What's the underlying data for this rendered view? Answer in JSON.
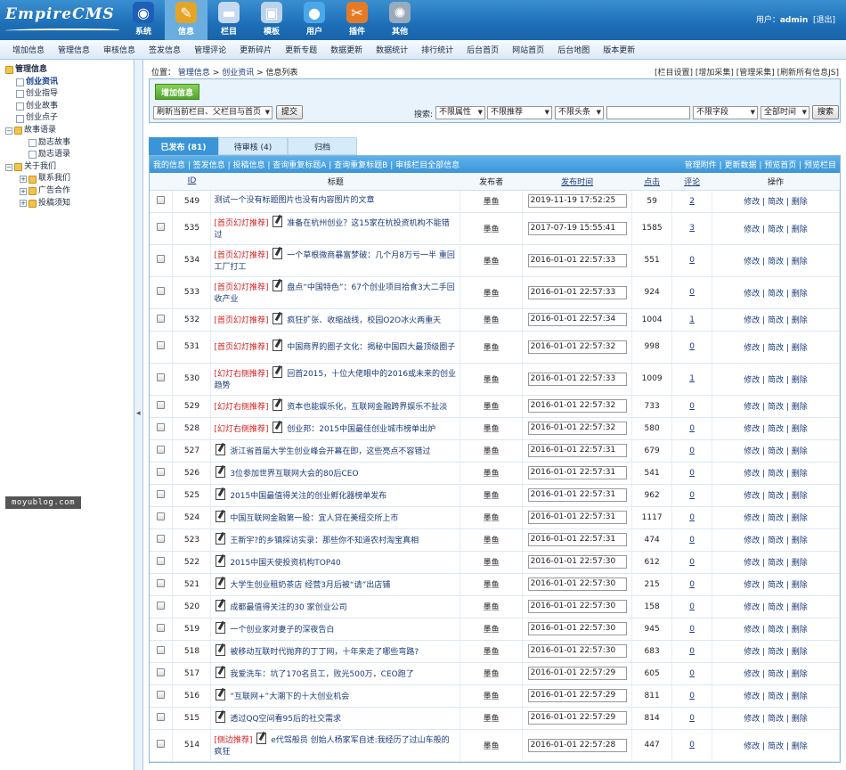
{
  "app": {
    "logo": "EmpireCMS"
  },
  "topnav": [
    {
      "label": "系统",
      "icon": "globe-icon"
    },
    {
      "label": "信息",
      "icon": "document-icon",
      "active": true
    },
    {
      "label": "栏目",
      "icon": "folder-icon"
    },
    {
      "label": "模板",
      "icon": "window-icon"
    },
    {
      "label": "用户",
      "icon": "user-icon"
    },
    {
      "label": "插件",
      "icon": "tools-icon"
    },
    {
      "label": "其他",
      "icon": "gear-icon"
    }
  ],
  "user": {
    "prefix": "用户：",
    "name": "admin",
    "logout": "[退出]"
  },
  "subnav": [
    "增加信息",
    "管理信息",
    "审核信息",
    "签发信息",
    "管理评论",
    "更新碎片",
    "更新专题",
    "数据更新",
    "数据统计",
    "排行统计",
    "后台首页",
    "网站首页",
    "后台地图",
    "版本更新"
  ],
  "sidebar": {
    "tree": [
      {
        "label": "管理信息",
        "level": 0,
        "type": "root"
      },
      {
        "label": "创业资讯",
        "level": 1,
        "type": "doc",
        "selected": true
      },
      {
        "label": "创业指导",
        "level": 1,
        "type": "doc"
      },
      {
        "label": "创业故事",
        "level": 1,
        "type": "doc"
      },
      {
        "label": "创业点子",
        "level": 1,
        "type": "doc"
      },
      {
        "label": "故事语录",
        "level": 0,
        "type": "open"
      },
      {
        "label": "励志故事",
        "level": 2,
        "type": "doc"
      },
      {
        "label": "励志语录",
        "level": 2,
        "type": "doc"
      },
      {
        "label": "关于我们",
        "level": 0,
        "type": "open"
      },
      {
        "label": "联系我们",
        "level": 1,
        "type": "closed"
      },
      {
        "label": "广告合作",
        "level": 1,
        "type": "closed"
      },
      {
        "label": "投稿须知",
        "level": 1,
        "type": "closed"
      }
    ]
  },
  "watermark": "moyublog.com",
  "breadcrumb": {
    "prefix": "位置：",
    "a": "管理信息",
    "sep": ">",
    "b": "创业资讯",
    "c": "信息列表"
  },
  "poslinks": "[栏目设置] [增加采集] [管理采集] [刷新所有信息JS]",
  "ops": {
    "add_label": "增加信息",
    "refresh_select": "刷新当前栏目、父栏目与首页",
    "submit_label": "提交",
    "search_label": "搜索:",
    "attr_select": "不限属性",
    "recommend_select": "不限推荐",
    "headline_select": "不限头条",
    "field_select": "不限字段",
    "time_select": "全部时间",
    "search_button": "搜索"
  },
  "tabs": [
    "已发布 (81)",
    "待审核 (4)",
    "归档"
  ],
  "gridbar": {
    "left": "我的信息 | 签发信息 | 投稿信息 | 查询重复标题A | 查询重复标题B | 审核栏目全部信息",
    "right": "管理附件 | 更新数据 | 预览首页 | 预览栏目"
  },
  "columns": [
    "ID",
    "标题",
    "发布者",
    "发布时间",
    "点击",
    "评论",
    "操作"
  ],
  "rows": [
    {
      "id": "549",
      "tag": "",
      "edit": false,
      "title": "测试一个没有标题图片也没有内容图片的文章",
      "author": "墨鱼",
      "time": "2019-11-19 17:52:25",
      "hits": "59",
      "comments": "2",
      "h": 25
    },
    {
      "id": "535",
      "tag": "[首页幻灯推荐]",
      "edit": true,
      "title": "准备在杭州创业？这15家在杭投资机构不能错过",
      "author": "墨鱼",
      "time": "2017-07-19 15:55:41",
      "hits": "1585",
      "comments": "3",
      "h": 36
    },
    {
      "id": "534",
      "tag": "[首页幻灯推荐]",
      "edit": true,
      "title": "一个草根微商暴富梦破：几个月8万亏一半 重回工厂打工",
      "author": "墨鱼",
      "time": "2016-01-01 22:57:33",
      "hits": "551",
      "comments": "0",
      "h": 36
    },
    {
      "id": "533",
      "tag": "[首页幻灯推荐]",
      "edit": true,
      "title": "盘点“中国特色”：67个创业项目拾食3大二手回收产业",
      "author": "墨鱼",
      "time": "2016-01-01 22:57:33",
      "hits": "924",
      "comments": "0",
      "h": 36
    },
    {
      "id": "532",
      "tag": "[首页幻灯推荐]",
      "edit": true,
      "title": "疯狂扩张、收缩战线，校园O2O冰火两重天",
      "author": "墨鱼",
      "time": "2016-01-01 22:57:34",
      "hits": "1004",
      "comments": "1",
      "h": 25
    },
    {
      "id": "531",
      "tag": "[首页幻灯推荐]",
      "edit": true,
      "title": "中国商界的圈子文化：揭秘中国四大最顶级圈子",
      "author": "墨鱼",
      "time": "2016-01-01 22:57:32",
      "hits": "998",
      "comments": "0",
      "h": 36
    },
    {
      "id": "530",
      "tag": "[幻灯右侧推荐]",
      "edit": true,
      "title": "回首2015，十位大佬眼中的2016或未来的创业趋势",
      "author": "墨鱼",
      "time": "2016-01-01 22:57:33",
      "hits": "1009",
      "comments": "1",
      "h": 36
    },
    {
      "id": "529",
      "tag": "[幻灯右侧推荐]",
      "edit": true,
      "title": "资本也能娱乐化，互联网金融跨界娱乐不扯淡",
      "author": "墨鱼",
      "time": "2016-01-01 22:57:32",
      "hits": "733",
      "comments": "0",
      "h": 25
    },
    {
      "id": "528",
      "tag": "[幻灯右侧推荐]",
      "edit": true,
      "title": "创业邦：2015中国最佳创业城市榜单出炉",
      "author": "墨鱼",
      "time": "2016-01-01 22:57:32",
      "hits": "580",
      "comments": "0",
      "h": 25
    },
    {
      "id": "527",
      "tag": "",
      "edit": true,
      "title": "浙江省首届大学生创业峰会开幕在即，这些亮点不容错过",
      "author": "墨鱼",
      "time": "2016-01-01 22:57:31",
      "hits": "679",
      "comments": "0",
      "h": 25
    },
    {
      "id": "526",
      "tag": "",
      "edit": true,
      "title": "3位参加世界互联网大会的80后CEO",
      "author": "墨鱼",
      "time": "2016-01-01 22:57:31",
      "hits": "541",
      "comments": "0",
      "h": 25
    },
    {
      "id": "525",
      "tag": "",
      "edit": true,
      "title": "2015中国最值得关注的创业孵化器榜单发布",
      "author": "墨鱼",
      "time": "2016-01-01 22:57:31",
      "hits": "962",
      "comments": "0",
      "h": 25
    },
    {
      "id": "524",
      "tag": "",
      "edit": true,
      "title": "中国互联网金融第一股：宜人贷在美纽交所上市",
      "author": "墨鱼",
      "time": "2016-01-01 22:57:31",
      "hits": "1117",
      "comments": "0",
      "h": 25
    },
    {
      "id": "523",
      "tag": "",
      "edit": true,
      "title": "王新宇?的乡镇探访实录：那些你不知道农村淘宝真相",
      "author": "墨鱼",
      "time": "2016-01-01 22:57:31",
      "hits": "474",
      "comments": "0",
      "h": 25
    },
    {
      "id": "522",
      "tag": "",
      "edit": true,
      "title": "2015中国天使投资机构TOP40",
      "author": "墨鱼",
      "time": "2016-01-01 22:57:30",
      "hits": "612",
      "comments": "0",
      "h": 25
    },
    {
      "id": "521",
      "tag": "",
      "edit": true,
      "title": "大学生创业租奶茶店 经营3月后被“请”出店铺",
      "author": "墨鱼",
      "time": "2016-01-01 22:57:30",
      "hits": "215",
      "comments": "0",
      "h": 25
    },
    {
      "id": "520",
      "tag": "",
      "edit": true,
      "title": "成都最值得关注的30 家创业公司",
      "author": "墨鱼",
      "time": "2016-01-01 22:57:30",
      "hits": "158",
      "comments": "0",
      "h": 25
    },
    {
      "id": "519",
      "tag": "",
      "edit": true,
      "title": "一个创业家对妻子的深夜告白",
      "author": "墨鱼",
      "time": "2016-01-01 22:57:30",
      "hits": "945",
      "comments": "0",
      "h": 25
    },
    {
      "id": "518",
      "tag": "",
      "edit": true,
      "title": "被移动互联时代抛弃的丁丁网，十年来走了哪些弯路?",
      "author": "墨鱼",
      "time": "2016-01-01 22:57:30",
      "hits": "683",
      "comments": "0",
      "h": 25
    },
    {
      "id": "517",
      "tag": "",
      "edit": true,
      "title": "我爱洗车：坑了170名员工，败光500万，CEO跑了",
      "author": "墨鱼",
      "time": "2016-01-01 22:57:29",
      "hits": "605",
      "comments": "0",
      "h": 25
    },
    {
      "id": "516",
      "tag": "",
      "edit": true,
      "title": "“互联网+”大潮下的十大创业机会",
      "author": "墨鱼",
      "time": "2016-01-01 22:57:29",
      "hits": "811",
      "comments": "0",
      "h": 25
    },
    {
      "id": "515",
      "tag": "",
      "edit": true,
      "title": "透过QQ空间看95后的社交需求",
      "author": "墨鱼",
      "time": "2016-01-01 22:57:29",
      "hits": "814",
      "comments": "0",
      "h": 25
    },
    {
      "id": "514",
      "tag": "[侧边推荐]",
      "edit": true,
      "title": "e代驾般员 创始人杨家军自述:我经历了过山车般的疯狂",
      "author": "墨鱼",
      "time": "2016-01-01 22:57:28",
      "hits": "447",
      "comments": "0",
      "h": 36
    }
  ],
  "row_ops": [
    "修改",
    "简改",
    "删除"
  ]
}
